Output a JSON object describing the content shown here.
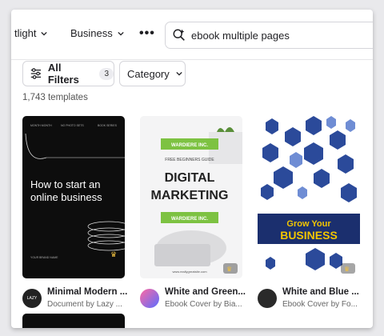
{
  "nav": {
    "item1_label": "tlight",
    "item2_label": "Business",
    "more_label": "•••"
  },
  "search": {
    "value": "ebook multiple pages"
  },
  "filters": {
    "all_label": "All Filters",
    "all_count": "3",
    "category_label": "Category"
  },
  "results_count": "1,743 templates",
  "cards": [
    {
      "title": "Minimal Modern ...",
      "subtitle": "Document by Lazy ...",
      "headline_1": "How to start an",
      "headline_2": "online business",
      "top_text_1": "MONTH MONTH",
      "top_text_2": "NO PHOTO SETS",
      "top_text_3": "BOOK SERIES",
      "footer_text": "YOUR BRAND NAME",
      "avatar_text": "LAZY",
      "bg": "#0d0d0d"
    },
    {
      "title": "White and Green...",
      "subtitle": "Ebook Cover by Bia...",
      "brand": "WARDIERE INC.",
      "guide": "FREE BEGINNERS GUIDE",
      "headline_1": "DIGITAL",
      "headline_2": "MARKETING",
      "brand_bottom": "WARDIERE INC.",
      "url": "www.reallygreatsite.com",
      "accent": "#7dc242"
    },
    {
      "title": "White and Blue ...",
      "subtitle": "Ebook Cover by Fo...",
      "headline_1": "Grow Your",
      "headline_2": "BUSINESS",
      "accent": "#f2c500",
      "navy": "#1b2f6e"
    }
  ]
}
